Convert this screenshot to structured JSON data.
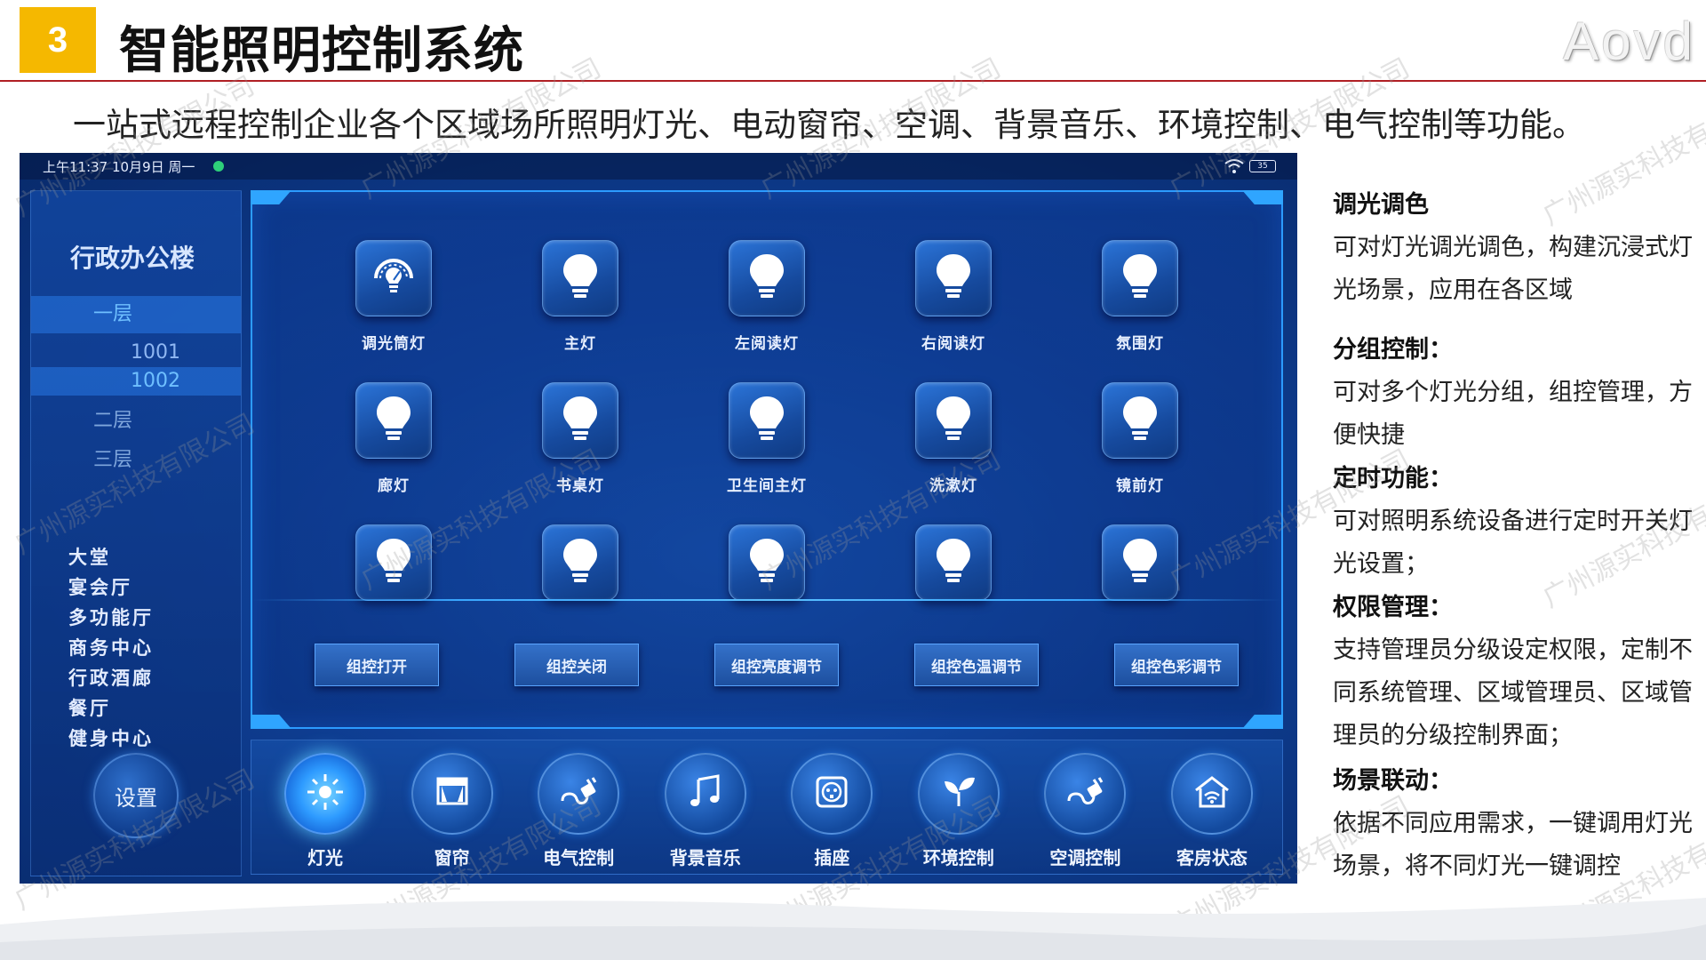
{
  "slide": {
    "badge": "3",
    "title": "智能照明控制系统",
    "brand": "Aovd",
    "subtitle": "一站式远程控制企业各个区域场所照明灯光、电动窗帘、空调、背景音乐、环境控制、电气控制等功能。"
  },
  "status_bar": {
    "time": "上午11:37 10月9日 周一",
    "battery": "35"
  },
  "sidebar": {
    "building": "行政办公楼",
    "floor_active": "一层",
    "rooms": [
      "1001",
      "1002"
    ],
    "floors": [
      "二层",
      "三层"
    ],
    "areas": [
      "大堂",
      "宴会厅",
      "多功能厅",
      "商务中心",
      "行政酒廊",
      "餐厅",
      "健身中心"
    ],
    "settings": "设置"
  },
  "lights": [
    {
      "label": "调光筒灯",
      "icon": "dimmer-gauge-icon"
    },
    {
      "label": "主灯",
      "icon": "bulb-icon"
    },
    {
      "label": "左阅读灯",
      "icon": "bulb-icon"
    },
    {
      "label": "右阅读灯",
      "icon": "bulb-icon"
    },
    {
      "label": "氛围灯",
      "icon": "bulb-icon"
    },
    {
      "label": "廊灯",
      "icon": "bulb-icon"
    },
    {
      "label": "书桌灯",
      "icon": "bulb-icon"
    },
    {
      "label": "卫生间主灯",
      "icon": "bulb-icon"
    },
    {
      "label": "洗漱灯",
      "icon": "bulb-icon"
    },
    {
      "label": "镜前灯",
      "icon": "bulb-icon"
    },
    {
      "label": "",
      "icon": "bulb-icon"
    },
    {
      "label": "",
      "icon": "bulb-icon"
    },
    {
      "label": "",
      "icon": "bulb-icon"
    },
    {
      "label": "",
      "icon": "bulb-icon"
    },
    {
      "label": "",
      "icon": "bulb-icon"
    }
  ],
  "group_controls": [
    "组控打开",
    "组控关闭",
    "组控亮度调节",
    "组控色温调节",
    "组控色彩调节"
  ],
  "dock": [
    {
      "label": "灯光",
      "icon": "sun-icon",
      "active": true
    },
    {
      "label": "窗帘",
      "icon": "curtain-icon"
    },
    {
      "label": "电气控制",
      "icon": "plug-icon"
    },
    {
      "label": "背景音乐",
      "icon": "music-note-icon"
    },
    {
      "label": "插座",
      "icon": "socket-icon"
    },
    {
      "label": "环境控制",
      "icon": "leaf-icon"
    },
    {
      "label": "空调控制",
      "icon": "plug-icon"
    },
    {
      "label": "客房状态",
      "icon": "smart-home-icon"
    }
  ],
  "description": [
    {
      "heading": "调光调色",
      "text": "可对灯光调光调色，构建沉浸式灯光场景，应用在各区域"
    },
    {
      "heading": "分组控制：",
      "text": "可对多个灯光分组，组控管理，方便快捷"
    },
    {
      "heading": "定时功能：",
      "text": "可对照明系统设备进行定时开关灯光设置；"
    },
    {
      "heading": "权限管理：",
      "text": "支持管理员分级设定权限，定制不同系统管理、区域管理员、区域管理员的分级控制界面；"
    },
    {
      "heading": "场景联动：",
      "text": "依据不同应用需求，一键调用灯光场景，将不同灯光一键调控"
    }
  ],
  "watermark": "广州源实科技有限公司",
  "colors": {
    "badge": "#f5b800",
    "rule": "#b01f24",
    "panel_border": "#2c9bff",
    "screen_bg": "#0f3f95"
  }
}
